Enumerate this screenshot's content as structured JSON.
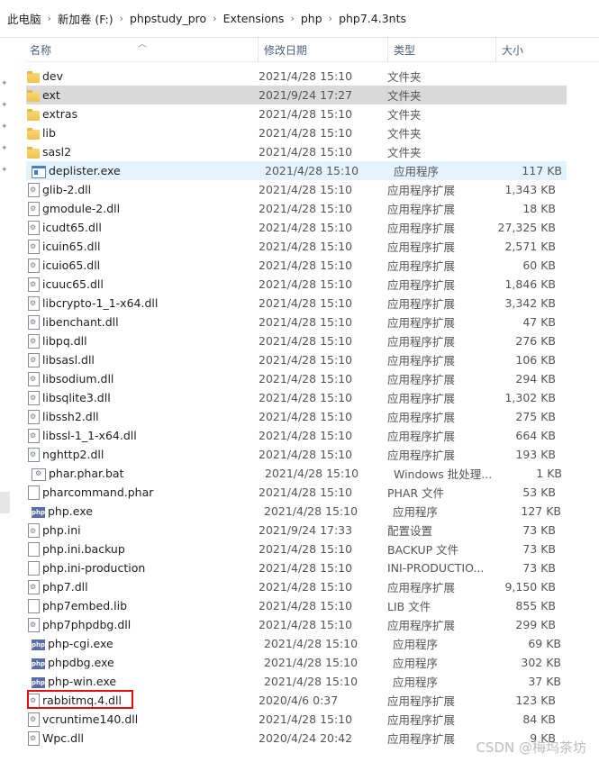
{
  "breadcrumb": [
    "此电脑",
    "新加卷 (F:)",
    "phpstudy_pro",
    "Extensions",
    "php",
    "php7.4.3nts"
  ],
  "columns": {
    "name": "名称",
    "date": "修改日期",
    "type": "类型",
    "size": "大小"
  },
  "files": [
    {
      "name": "dev",
      "date": "2021/4/28 15:10",
      "type": "文件夹",
      "size": "",
      "icon": "folder"
    },
    {
      "name": "ext",
      "date": "2021/9/24 17:27",
      "type": "文件夹",
      "size": "",
      "icon": "folder"
    },
    {
      "name": "extras",
      "date": "2021/4/28 15:10",
      "type": "文件夹",
      "size": "",
      "icon": "folder"
    },
    {
      "name": "lib",
      "date": "2021/4/28 15:10",
      "type": "文件夹",
      "size": "",
      "icon": "folder"
    },
    {
      "name": "sasl2",
      "date": "2021/4/28 15:10",
      "type": "文件夹",
      "size": "",
      "icon": "folder"
    },
    {
      "name": "deplister.exe",
      "date": "2021/4/28 15:10",
      "type": "应用程序",
      "size": "117 KB",
      "icon": "exe"
    },
    {
      "name": "glib-2.dll",
      "date": "2021/4/28 15:10",
      "type": "应用程序扩展",
      "size": "1,343 KB",
      "icon": "dll"
    },
    {
      "name": "gmodule-2.dll",
      "date": "2021/4/28 15:10",
      "type": "应用程序扩展",
      "size": "18 KB",
      "icon": "dll"
    },
    {
      "name": "icudt65.dll",
      "date": "2021/4/28 15:10",
      "type": "应用程序扩展",
      "size": "27,325 KB",
      "icon": "dll"
    },
    {
      "name": "icuin65.dll",
      "date": "2021/4/28 15:10",
      "type": "应用程序扩展",
      "size": "2,571 KB",
      "icon": "dll"
    },
    {
      "name": "icuio65.dll",
      "date": "2021/4/28 15:10",
      "type": "应用程序扩展",
      "size": "60 KB",
      "icon": "dll"
    },
    {
      "name": "icuuc65.dll",
      "date": "2021/4/28 15:10",
      "type": "应用程序扩展",
      "size": "1,846 KB",
      "icon": "dll"
    },
    {
      "name": "libcrypto-1_1-x64.dll",
      "date": "2021/4/28 15:10",
      "type": "应用程序扩展",
      "size": "3,342 KB",
      "icon": "dll"
    },
    {
      "name": "libenchant.dll",
      "date": "2021/4/28 15:10",
      "type": "应用程序扩展",
      "size": "47 KB",
      "icon": "dll"
    },
    {
      "name": "libpq.dll",
      "date": "2021/4/28 15:10",
      "type": "应用程序扩展",
      "size": "276 KB",
      "icon": "dll"
    },
    {
      "name": "libsasl.dll",
      "date": "2021/4/28 15:10",
      "type": "应用程序扩展",
      "size": "106 KB",
      "icon": "dll"
    },
    {
      "name": "libsodium.dll",
      "date": "2021/4/28 15:10",
      "type": "应用程序扩展",
      "size": "294 KB",
      "icon": "dll"
    },
    {
      "name": "libsqlite3.dll",
      "date": "2021/4/28 15:10",
      "type": "应用程序扩展",
      "size": "1,302 KB",
      "icon": "dll"
    },
    {
      "name": "libssh2.dll",
      "date": "2021/4/28 15:10",
      "type": "应用程序扩展",
      "size": "275 KB",
      "icon": "dll"
    },
    {
      "name": "libssl-1_1-x64.dll",
      "date": "2021/4/28 15:10",
      "type": "应用程序扩展",
      "size": "664 KB",
      "icon": "dll"
    },
    {
      "name": "nghttp2.dll",
      "date": "2021/4/28 15:10",
      "type": "应用程序扩展",
      "size": "193 KB",
      "icon": "dll"
    },
    {
      "name": "phar.phar.bat",
      "date": "2021/4/28 15:10",
      "type": "Windows 批处理...",
      "size": "1 KB",
      "icon": "bat"
    },
    {
      "name": "pharcommand.phar",
      "date": "2021/4/28 15:10",
      "type": "PHAR 文件",
      "size": "53 KB",
      "icon": "file"
    },
    {
      "name": "php.exe",
      "date": "2021/4/28 15:10",
      "type": "应用程序",
      "size": "127 KB",
      "icon": "php"
    },
    {
      "name": "php.ini",
      "date": "2021/9/24 17:33",
      "type": "配置设置",
      "size": "73 KB",
      "icon": "ini"
    },
    {
      "name": "php.ini.backup",
      "date": "2021/4/28 15:10",
      "type": "BACKUP 文件",
      "size": "73 KB",
      "icon": "file"
    },
    {
      "name": "php.ini-production",
      "date": "2021/4/28 15:10",
      "type": "INI-PRODUCTIO...",
      "size": "73 KB",
      "icon": "file"
    },
    {
      "name": "php7.dll",
      "date": "2021/4/28 15:10",
      "type": "应用程序扩展",
      "size": "9,150 KB",
      "icon": "dll"
    },
    {
      "name": "php7embed.lib",
      "date": "2021/4/28 15:10",
      "type": "LIB 文件",
      "size": "855 KB",
      "icon": "file"
    },
    {
      "name": "php7phpdbg.dll",
      "date": "2021/4/28 15:10",
      "type": "应用程序扩展",
      "size": "299 KB",
      "icon": "dll"
    },
    {
      "name": "php-cgi.exe",
      "date": "2021/4/28 15:10",
      "type": "应用程序",
      "size": "69 KB",
      "icon": "php"
    },
    {
      "name": "phpdbg.exe",
      "date": "2021/4/28 15:10",
      "type": "应用程序",
      "size": "302 KB",
      "icon": "php"
    },
    {
      "name": "php-win.exe",
      "date": "2021/4/28 15:10",
      "type": "应用程序",
      "size": "37 KB",
      "icon": "php"
    },
    {
      "name": "rabbitmq.4.dll",
      "date": "2020/4/6 0:37",
      "type": "应用程序扩展",
      "size": "123 KB",
      "icon": "dll"
    },
    {
      "name": "vcruntime140.dll",
      "date": "2021/4/28 15:10",
      "type": "应用程序扩展",
      "size": "84 KB",
      "icon": "dll"
    },
    {
      "name": "Wpc.dll",
      "date": "2020/4/24 20:42",
      "type": "应用程序扩展",
      "size": "9 KB",
      "icon": "dll"
    }
  ],
  "selected_index": 1,
  "hover_index": 5,
  "highlight_color": "#e01010",
  "icon_php_text": "php",
  "watermark": "CSDN @梅坞茶坊"
}
